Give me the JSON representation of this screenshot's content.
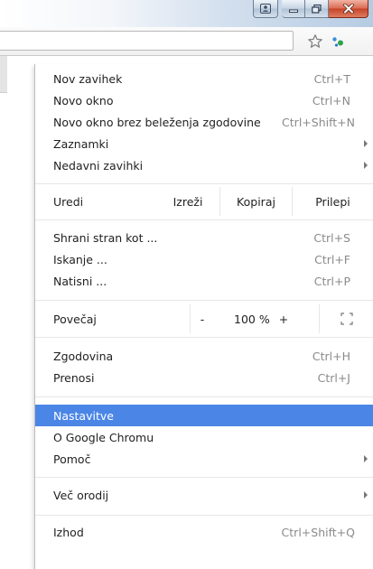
{
  "toolbar": {
    "star_icon": "star-outline-icon",
    "extension_icon": "extension-icon",
    "menu_icon": "hamburger-menu-icon"
  },
  "menu": {
    "section1": [
      {
        "label": "Nov zavihek",
        "shortcut": "Ctrl+T"
      },
      {
        "label": "Novo okno",
        "shortcut": "Ctrl+N"
      },
      {
        "label": "Novo okno brez beleženja zgodovine",
        "shortcut": "Ctrl+Shift+N"
      },
      {
        "label": "Zaznamki",
        "submenu": true
      },
      {
        "label": "Nedavni zavihki",
        "submenu": true
      }
    ],
    "edit": {
      "label": "Uredi",
      "cut": "Izreži",
      "copy": "Kopiraj",
      "paste": "Prilepi"
    },
    "section2": [
      {
        "label": "Shrani stran kot ...",
        "shortcut": "Ctrl+S"
      },
      {
        "label": "Iskanje ...",
        "shortcut": "Ctrl+F"
      },
      {
        "label": "Natisni ...",
        "shortcut": "Ctrl+P"
      }
    ],
    "zoom": {
      "label": "Povečaj",
      "minus": "-",
      "level": "100 %",
      "plus": "+"
    },
    "section3": [
      {
        "label": "Zgodovina",
        "shortcut": "Ctrl+H"
      },
      {
        "label": "Prenosi",
        "shortcut": "Ctrl+J"
      }
    ],
    "section4": [
      {
        "label": "Nastavitve",
        "selected": true
      },
      {
        "label": "O Google Chromu"
      },
      {
        "label": "Pomoč",
        "submenu": true
      }
    ],
    "section5": [
      {
        "label": "Več orodij",
        "submenu": true
      }
    ],
    "section6": [
      {
        "label": "Izhod",
        "shortcut": "Ctrl+Shift+Q"
      }
    ]
  },
  "colors": {
    "selection": "#4b86e6",
    "shortcut_text": "#8a8a8a",
    "separator": "#e7e7e7"
  }
}
